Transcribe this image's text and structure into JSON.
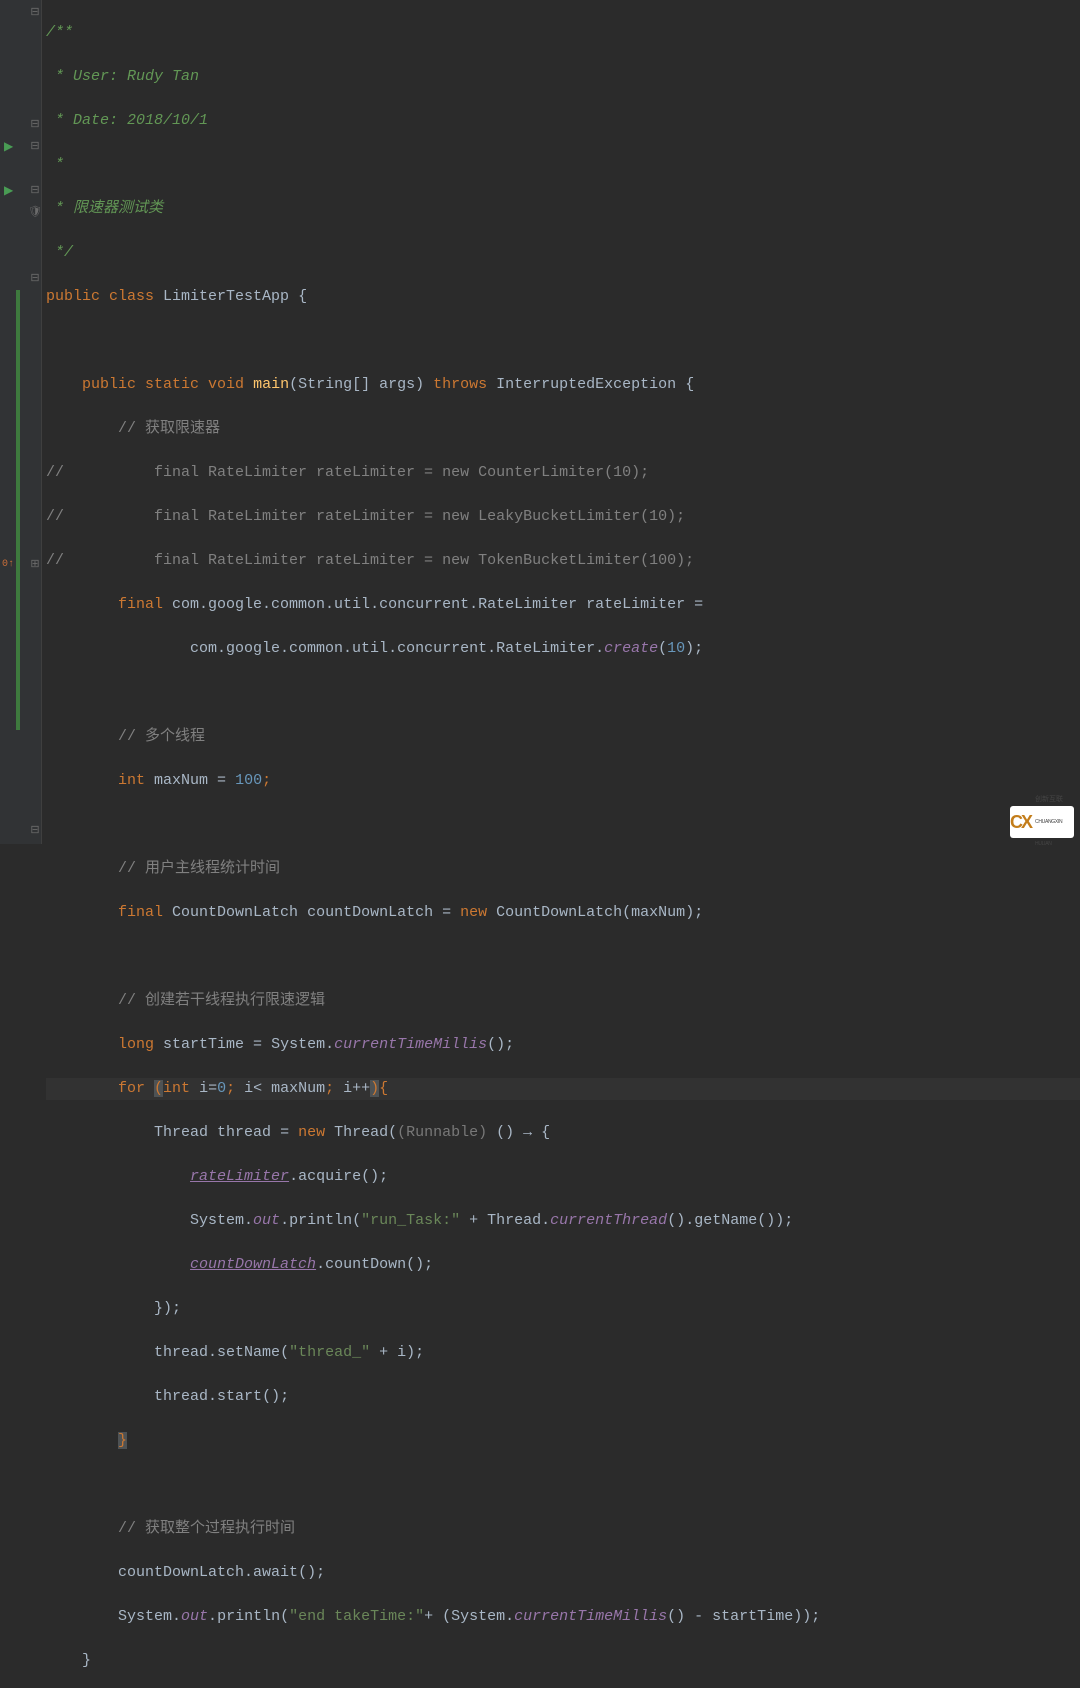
{
  "doc": {
    "open": "/**",
    "user": " * User: Rudy Tan",
    "date": " * Date: 2018/10/1",
    "star": " *",
    "desc": " * 限速器测试类",
    "close": " */"
  },
  "cls": {
    "kw_public": "public ",
    "kw_class": "class ",
    "name": "LimiterTestApp ",
    "brace": "{"
  },
  "main": {
    "indent": "    ",
    "kw_public": "public ",
    "kw_static": "static ",
    "kw_void": "void ",
    "name": "main",
    "params_open": "(",
    "param_type": "String[] ",
    "param_name": "args",
    "params_close": ") ",
    "kw_throws": "throws ",
    "exc": "InterruptedException ",
    "brace": "{"
  },
  "c_get": "        // 获取限速器",
  "l_counter": {
    "pre": "//          final RateLimiter rateLimiter = new CounterLimiter(10);"
  },
  "l_leaky": {
    "pre": "//          final RateLimiter rateLimiter = new LeakyBucketLimiter(10);"
  },
  "l_token": {
    "pre": "//          final RateLimiter rateLimiter = new TokenBucketLimiter(100);"
  },
  "l_guava1": {
    "indent": "        ",
    "kw_final": "final ",
    "type": "com.google.common.util.concurrent.RateLimiter ",
    "var": "rateLimiter ",
    "eq": "="
  },
  "l_guava2": {
    "indent": "                ",
    "type": "com.google.common.util.concurrent.RateLimiter.",
    "method": "create",
    "open": "(",
    "arg": "10",
    "close": ");"
  },
  "c_threads": "        // 多个线程",
  "l_maxnum": {
    "indent": "        ",
    "kw_int": "int ",
    "var": "maxNum ",
    "eq": "= ",
    "val": "100",
    "semi": ";"
  },
  "c_maintime": "        // 用户主线程统计时间",
  "l_cdl": {
    "indent": "        ",
    "kw_final": "final ",
    "type": "CountDownLatch ",
    "var": "countDownLatch ",
    "eq": "= ",
    "kw_new": "new ",
    "ctor": "CountDownLatch",
    "open": "(",
    "arg": "maxNum",
    "close": ");"
  },
  "c_forloop": "        // 创建若干线程执行限速逻辑",
  "l_start": {
    "indent": "        ",
    "kw_long": "long ",
    "var": "startTime ",
    "eq": "= ",
    "cls": "System.",
    "method": "currentTimeMillis",
    "call": "();"
  },
  "l_for": {
    "indent": "        ",
    "kw_for": "for ",
    "open": "(",
    "kw_int": "int ",
    "init": "i=",
    "zero": "0",
    "sep1": "; ",
    "cond": "i< maxNum",
    "sep2": "; ",
    "inc": "i++",
    "close": ")",
    "brace": "{"
  },
  "l_thread": {
    "indent": "            ",
    "type": "Thread ",
    "var": "thread ",
    "eq": "= ",
    "kw_new": "new ",
    "ctor": "Thread(",
    "hint": "(Runnable) ",
    "lambda": "() → {"
  },
  "l_acq": {
    "indent": "                ",
    "obj": "rateLimiter",
    "dot": ".",
    "method": "acquire",
    "call": "();"
  },
  "l_print": {
    "indent": "                ",
    "sys": "System.",
    "out": "out",
    "dot": ".",
    "println": "println(",
    "str": "\"run_Task:\"",
    "plus": " + ",
    "thread": "Thread.",
    "cur": "currentThread",
    "call1": "().",
    "getname": "getName",
    "call2": "());"
  },
  "l_cd": {
    "indent": "                ",
    "obj": "countDownLatch",
    "dot": ".",
    "method": "countDown",
    "call": "();"
  },
  "l_lambda_close": "            });",
  "l_setname": {
    "indent": "            ",
    "obj": "thread.",
    "method": "setName",
    "open": "(",
    "str": "\"thread_\"",
    "plus": " + ",
    "i": "i",
    "close": ");"
  },
  "l_tstart": {
    "indent": "            ",
    "obj": "thread.",
    "method": "start",
    "call": "();"
  },
  "l_forclose": {
    "indent": "        ",
    "brace": "}"
  },
  "c_gettime": "        // 获取整个过程执行时间",
  "l_await": {
    "indent": "        ",
    "obj": "countDownLatch.",
    "method": "await",
    "call": "();"
  },
  "l_end": {
    "indent": "        ",
    "sys": "System.",
    "out": "out",
    "dot": ".",
    "println": "println(",
    "str": "\"end takeTime:\"",
    "plus": "+ (",
    "cls": "System.",
    "method": "currentTimeMillis",
    "call": "() - startTime));"
  },
  "l_mainclose": "    }",
  "logo": {
    "brand": "创新互联",
    "sub": "CHUANGXIN HULIAN"
  }
}
